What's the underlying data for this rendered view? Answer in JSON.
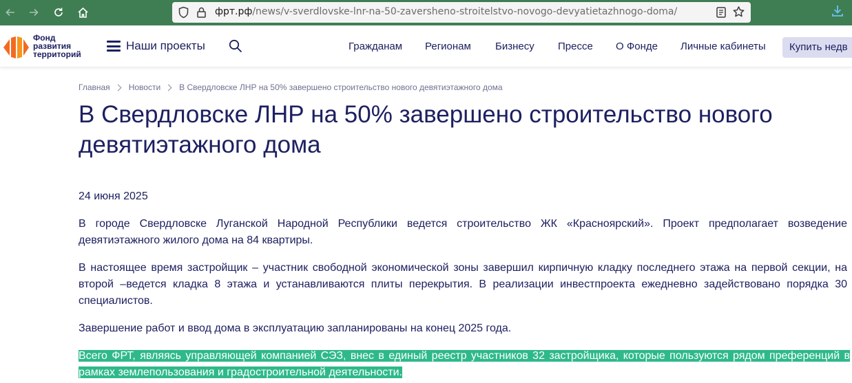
{
  "browser": {
    "url_domain": "фрт.рф",
    "url_path": "/news/v-sverdlovske-lnr-na-50-zaversheno-stroitelstvo-novogo-devyatietazhnogo-doma/"
  },
  "logo": {
    "line1": "Фонд",
    "line2": "развития",
    "line3": "территорий"
  },
  "header": {
    "projects_label": "Наши проекты",
    "nav": [
      {
        "label": "Гражданам"
      },
      {
        "label": "Регионам"
      },
      {
        "label": "Бизнесу"
      },
      {
        "label": "Прессе"
      },
      {
        "label": "О Фонде"
      },
      {
        "label": "Личные кабинеты"
      }
    ],
    "buy_label": "Купить недв"
  },
  "breadcrumb": {
    "home": "Главная",
    "news": "Новости",
    "current": "В Свердловске ЛНР на 50% завершено строительство нового девятиэтажного дома"
  },
  "article": {
    "title": "В Свердловске ЛНР на 50% завершено строительство нового девятиэтажного дома",
    "date": "24 июня 2025",
    "paragraphs": [
      "В городе Свердловске Луганской Народной Республики ведется строительство ЖК «Красноярский». Проект предполагает возведение девятиэтажного жилого дома на 84 квартиры.",
      "В настоящее время застройщик – участник свободной экономической зоны завершил кирпичную кладку последнего этажа на первой секции, на второй –ведется кладка 8 этажа и устанавливаются плиты перекрытия. В реализации инвестпроекта ежедневно задействовано порядка 30 специалистов.",
      "Завершение работ и ввод дома в эксплуатацию запланированы на конец 2025 года.",
      "Всего ФРТ, являясь управляющей компанией СЭЗ, внес в единый реестр участников 32 застройщика, которые пользуются рядом преференций в рамках землепользования и градостроительной деятельности."
    ]
  },
  "colors": {
    "browser_bar": "#3f7d53",
    "brand_navy": "#1d2060",
    "brand_orange": "#f26a21",
    "highlight": "#2fb98a"
  }
}
